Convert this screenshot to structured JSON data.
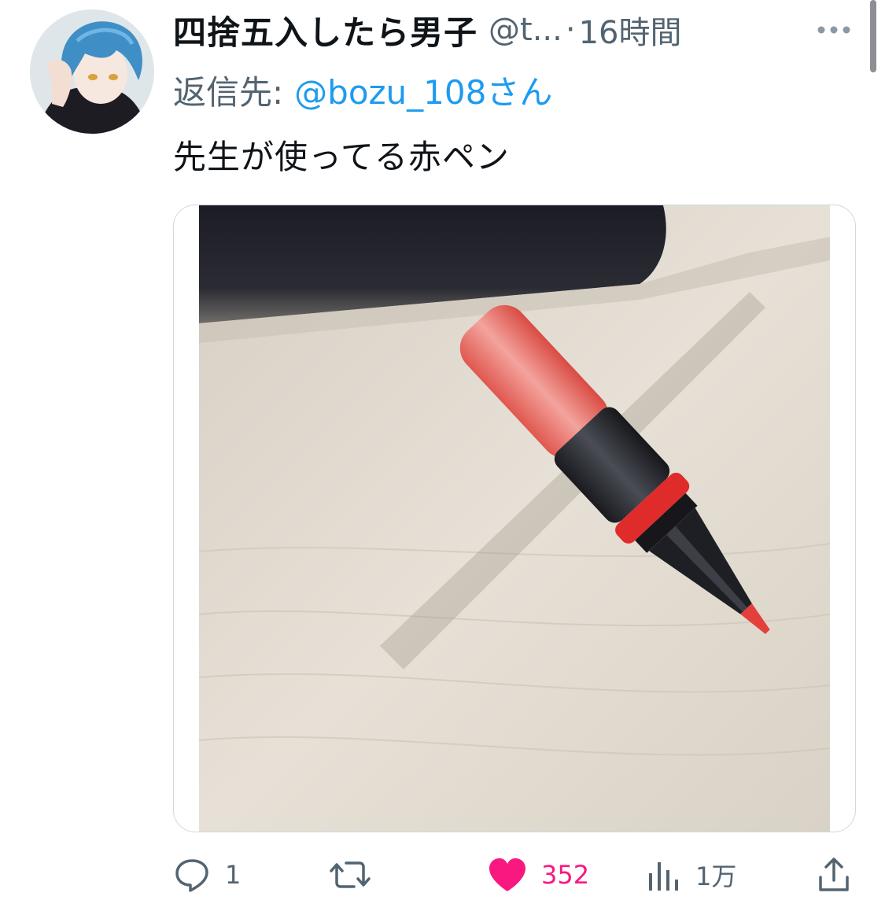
{
  "tweet": {
    "display_name": "四捨五入したら男子",
    "handle": "@t...",
    "separator": "·",
    "time": "16時間",
    "reply_prefix": "返信先:",
    "reply_handle": "@bozu_108さん",
    "text": "先生が使ってる赤ペン"
  },
  "media": {
    "icon": "photo-red-pen"
  },
  "actions": {
    "reply_count": "1",
    "retweet_count": "",
    "like_count": "352",
    "views_count": "1万",
    "liked": true
  },
  "icons": {
    "more": "more-dots-icon",
    "reply": "reply-icon",
    "retweet": "retweet-icon",
    "like": "heart-icon",
    "views": "views-icon",
    "share": "share-icon"
  },
  "colors": {
    "link": "#1d9bf0",
    "secondary_text": "#536471",
    "like": "#f91880",
    "primary_text": "#0f1419"
  }
}
